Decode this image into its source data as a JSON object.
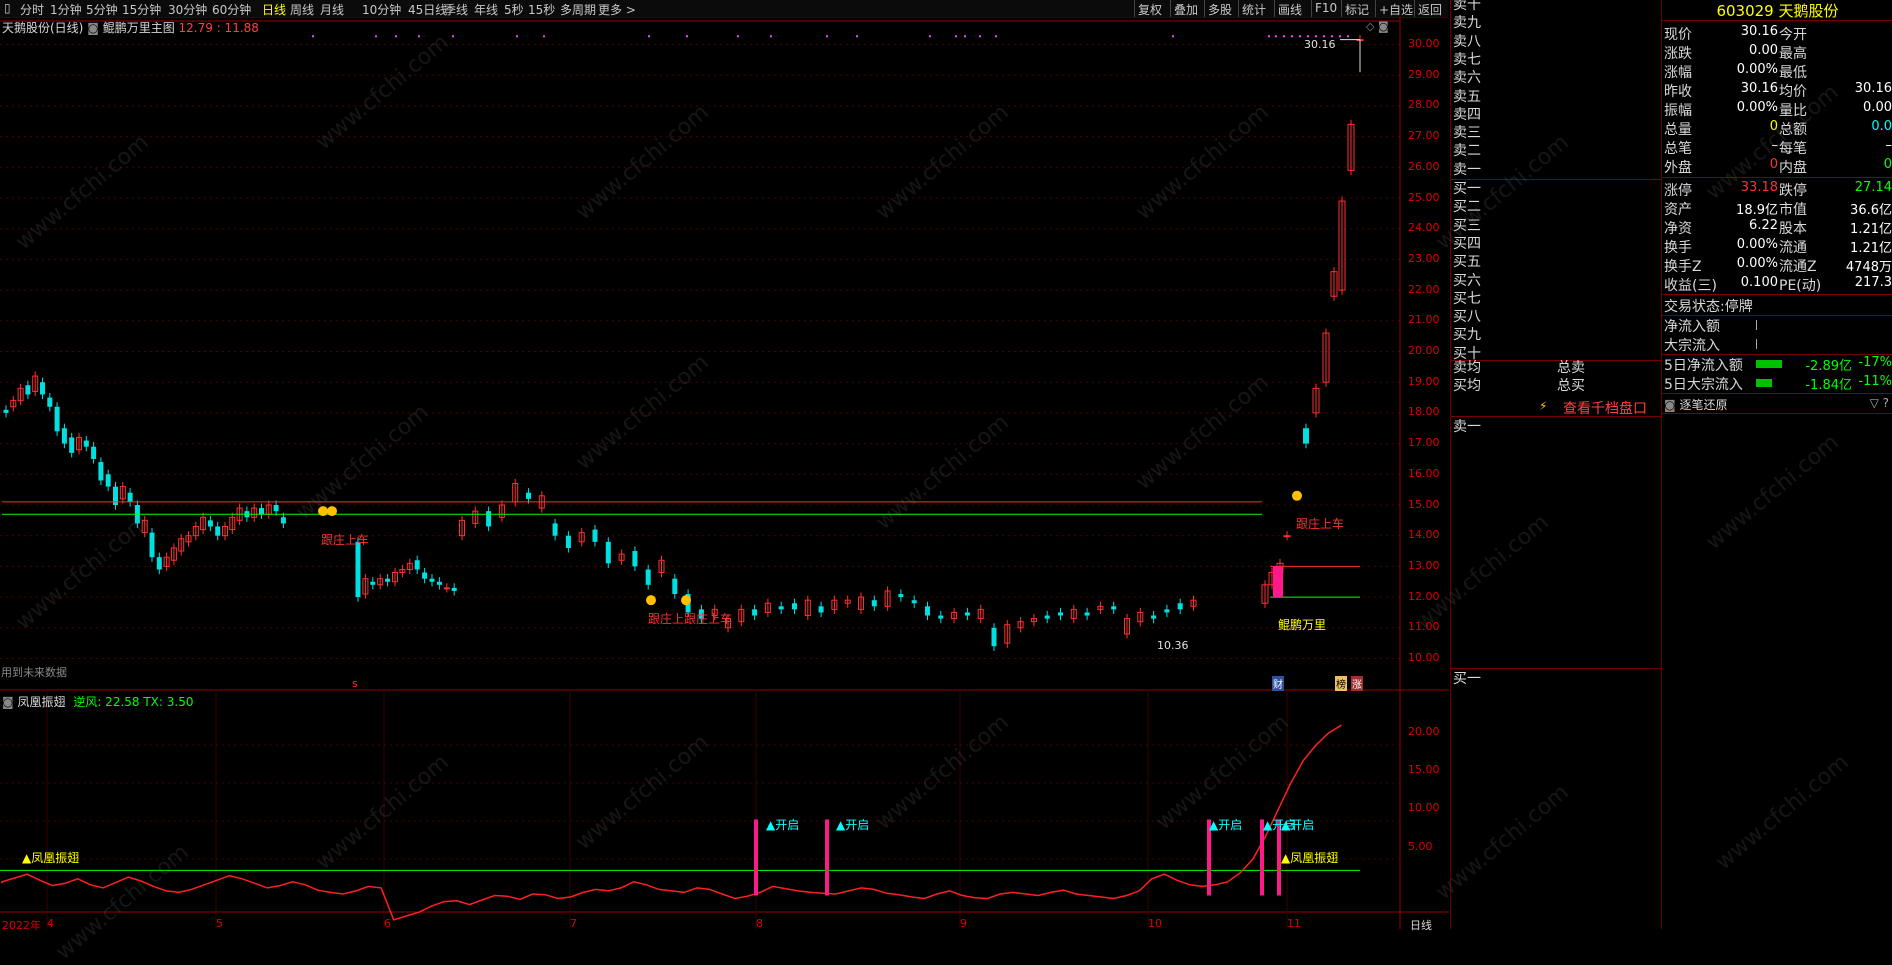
{
  "toolbar": {
    "items": [
      "分时",
      "1分钟",
      "5分钟",
      "15分钟",
      "30分钟",
      "60分钟",
      "日线",
      "周线",
      "月线",
      "10分钟",
      "45日线",
      "季线",
      "年线",
      "5秒",
      "15秒",
      "多周期",
      "更多 >"
    ],
    "active_index": 6,
    "right_items": [
      "复权",
      "叠加",
      "多股",
      "统计",
      "画线",
      "F10",
      "标记",
      "+自选",
      "返回"
    ]
  },
  "main": {
    "stock_label": "天鹅股份(日线)",
    "indicator_name": "鲲鹏万里主图",
    "indicator_values": "12.79 : 11.88",
    "price_ticks": [
      "30.00",
      "29.00",
      "28.00",
      "27.00",
      "26.00",
      "25.00",
      "24.00",
      "23.00",
      "22.00",
      "21.00",
      "20.00",
      "19.00",
      "18.00",
      "17.00",
      "16.00",
      "15.00",
      "14.00",
      "13.00",
      "12.00",
      "11.00",
      "10.00"
    ],
    "annotations": {
      "high_label": "30.16",
      "low_label": "10.36",
      "follow_1": "跟庄上车",
      "follow_2": "跟庄上跟庄上车",
      "follow_3": "跟庄上车",
      "kunpeng": "鲲鹏万里",
      "future_data": "用到未来数据",
      "marker_s": "s",
      "badge_cai": "财",
      "badge_bang": "榜",
      "badge_zhang": "涨"
    }
  },
  "indicator": {
    "name": "凤凰振翅",
    "values": "逆风: 22.58  TX: 3.50",
    "ticks": [
      "20.00",
      "15.00",
      "10.00",
      "5.00"
    ],
    "open_label": "开启",
    "phoenix_label": "凤凰振翅",
    "x_labels": [
      "2022年",
      "4",
      "5",
      "6",
      "7",
      "8",
      "9",
      "10",
      "11"
    ],
    "period": "日线"
  },
  "orderbook": {
    "sell_labels": [
      "卖十",
      "卖九",
      "卖八",
      "卖七",
      "卖六",
      "卖五",
      "卖四",
      "卖三",
      "卖二",
      "卖一"
    ],
    "buy_labels": [
      "买一",
      "买二",
      "买三",
      "买四",
      "买五",
      "买六",
      "买七",
      "买八",
      "买九",
      "买十"
    ],
    "avg_sell": "卖均",
    "avg_buy": "买均",
    "total_sell": "总卖",
    "total_buy": "总买",
    "depth_link": "查看千档盘口",
    "sell1": "卖一",
    "buy1": "买一"
  },
  "quote": {
    "code": "603029",
    "name": "天鹅股份",
    "rows": [
      {
        "l1": "现价",
        "v1": "30.16",
        "c1": "#ffffff",
        "l2": "今开",
        "v2": "",
        "c2": "#ffffff"
      },
      {
        "l1": "涨跌",
        "v1": "0.00",
        "c1": "#ffffff",
        "l2": "最高",
        "v2": "",
        "c2": "#ffffff"
      },
      {
        "l1": "涨幅",
        "v1": "0.00%",
        "c1": "#ffffff",
        "l2": "最低",
        "v2": "",
        "c2": "#ffffff"
      },
      {
        "l1": "昨收",
        "v1": "30.16",
        "c1": "#ffffff",
        "l2": "均价",
        "v2": "30.16",
        "c2": "#ffffff"
      },
      {
        "l1": "振幅",
        "v1": "0.00%",
        "c1": "#ffffff",
        "l2": "量比",
        "v2": "0.00",
        "c2": "#ffffff"
      },
      {
        "l1": "总量",
        "v1": "0",
        "c1": "#ffff00",
        "l2": "总额",
        "v2": "0.0",
        "c2": "#00ffff"
      },
      {
        "l1": "总笔",
        "v1": "–",
        "c1": "#ffffff",
        "l2": "每笔",
        "v2": "–",
        "c2": "#ffffff"
      },
      {
        "l1": "外盘",
        "v1": "0",
        "c1": "#ff3030",
        "l2": "内盘",
        "v2": "0",
        "c2": "#00ff00"
      }
    ],
    "rows2": [
      {
        "l1": "涨停",
        "v1": "33.18",
        "c1": "#ff3030",
        "l2": "跌停",
        "v2": "27.14",
        "c2": "#00ff00"
      },
      {
        "l1": "资产",
        "v1": "18.9亿",
        "c1": "#ffffff",
        "l2": "市值",
        "v2": "36.6亿",
        "c2": "#ffffff"
      },
      {
        "l1": "净资",
        "v1": "6.22",
        "c1": "#ffffff",
        "l2": "股本",
        "v2": "1.21亿",
        "c2": "#ffffff"
      },
      {
        "l1": "换手",
        "v1": "0.00%",
        "c1": "#ffffff",
        "l2": "流通",
        "v2": "1.21亿",
        "c2": "#ffffff"
      },
      {
        "l1": "换手Z",
        "v1": "0.00%",
        "c1": "#ffffff",
        "l2": "流通Z",
        "v2": "4748万",
        "c2": "#ffffff"
      },
      {
        "l1": "收益(三)",
        "v1": "0.100",
        "c1": "#ffffff",
        "l2": "PE(动)",
        "v2": "217.3",
        "c2": "#ffffff"
      }
    ],
    "status_label": "交易状态:",
    "status_value": "停牌",
    "flow_in_label": "净流入额",
    "block_in_label": "大宗流入",
    "five_day_flow_label": "5日净流入额",
    "five_day_flow_value": "-2.89亿",
    "five_day_flow_pct": "-17%",
    "five_day_block_label": "5日大宗流入",
    "five_day_block_value": "-1.84亿",
    "five_day_block_pct": "-11%",
    "tick_panel": "逐笔还原",
    "tick_icons": "▽ ?"
  },
  "watermark": "www.cfchi.com"
}
